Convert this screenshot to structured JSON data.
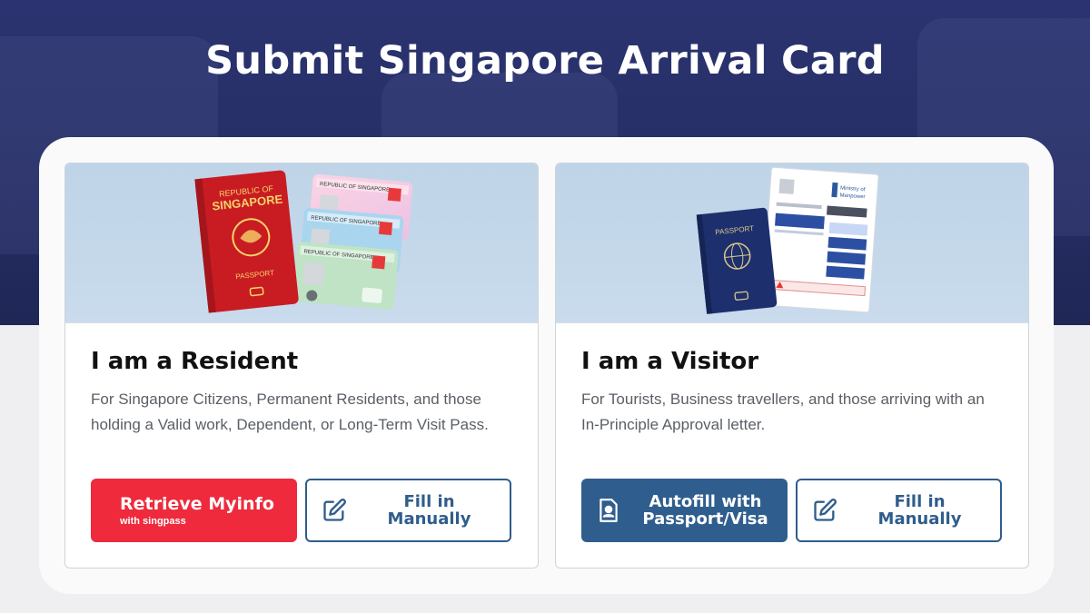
{
  "page": {
    "title": "Submit Singapore Arrival Card"
  },
  "resident": {
    "title": "I am a Resident",
    "description": "For Singapore Citizens, Permanent Residents, and those holding a Valid work, Dependent, or Long-Term Visit Pass.",
    "image_passport_text": [
      "REPUBLIC OF",
      "SINGAPORE",
      "PASSPORT"
    ],
    "image_card_text": "REPUBLIC OF SINGAPORE",
    "primary_button": {
      "label": "Retrieve Myinfo",
      "sublabel": "with singpass"
    },
    "secondary_button": {
      "label": "Fill in Manually",
      "icon": "edit-icon"
    }
  },
  "visitor": {
    "title": "I am a Visitor",
    "description": "For Tourists, Business travellers, and those arriving with an In-Principle Approval letter.",
    "image_passport_text": "PASSPORT",
    "image_doc_text": [
      "Ministry of",
      "Manpower"
    ],
    "primary_button": {
      "label": "Autofill with Passport/Visa",
      "icon": "id-document-icon"
    },
    "secondary_button": {
      "label": "Fill in Manually",
      "icon": "edit-icon"
    }
  },
  "colors": {
    "hero": "#252d63",
    "singpass_red": "#ee2a3c",
    "accent_blue": "#2f5e8e"
  }
}
